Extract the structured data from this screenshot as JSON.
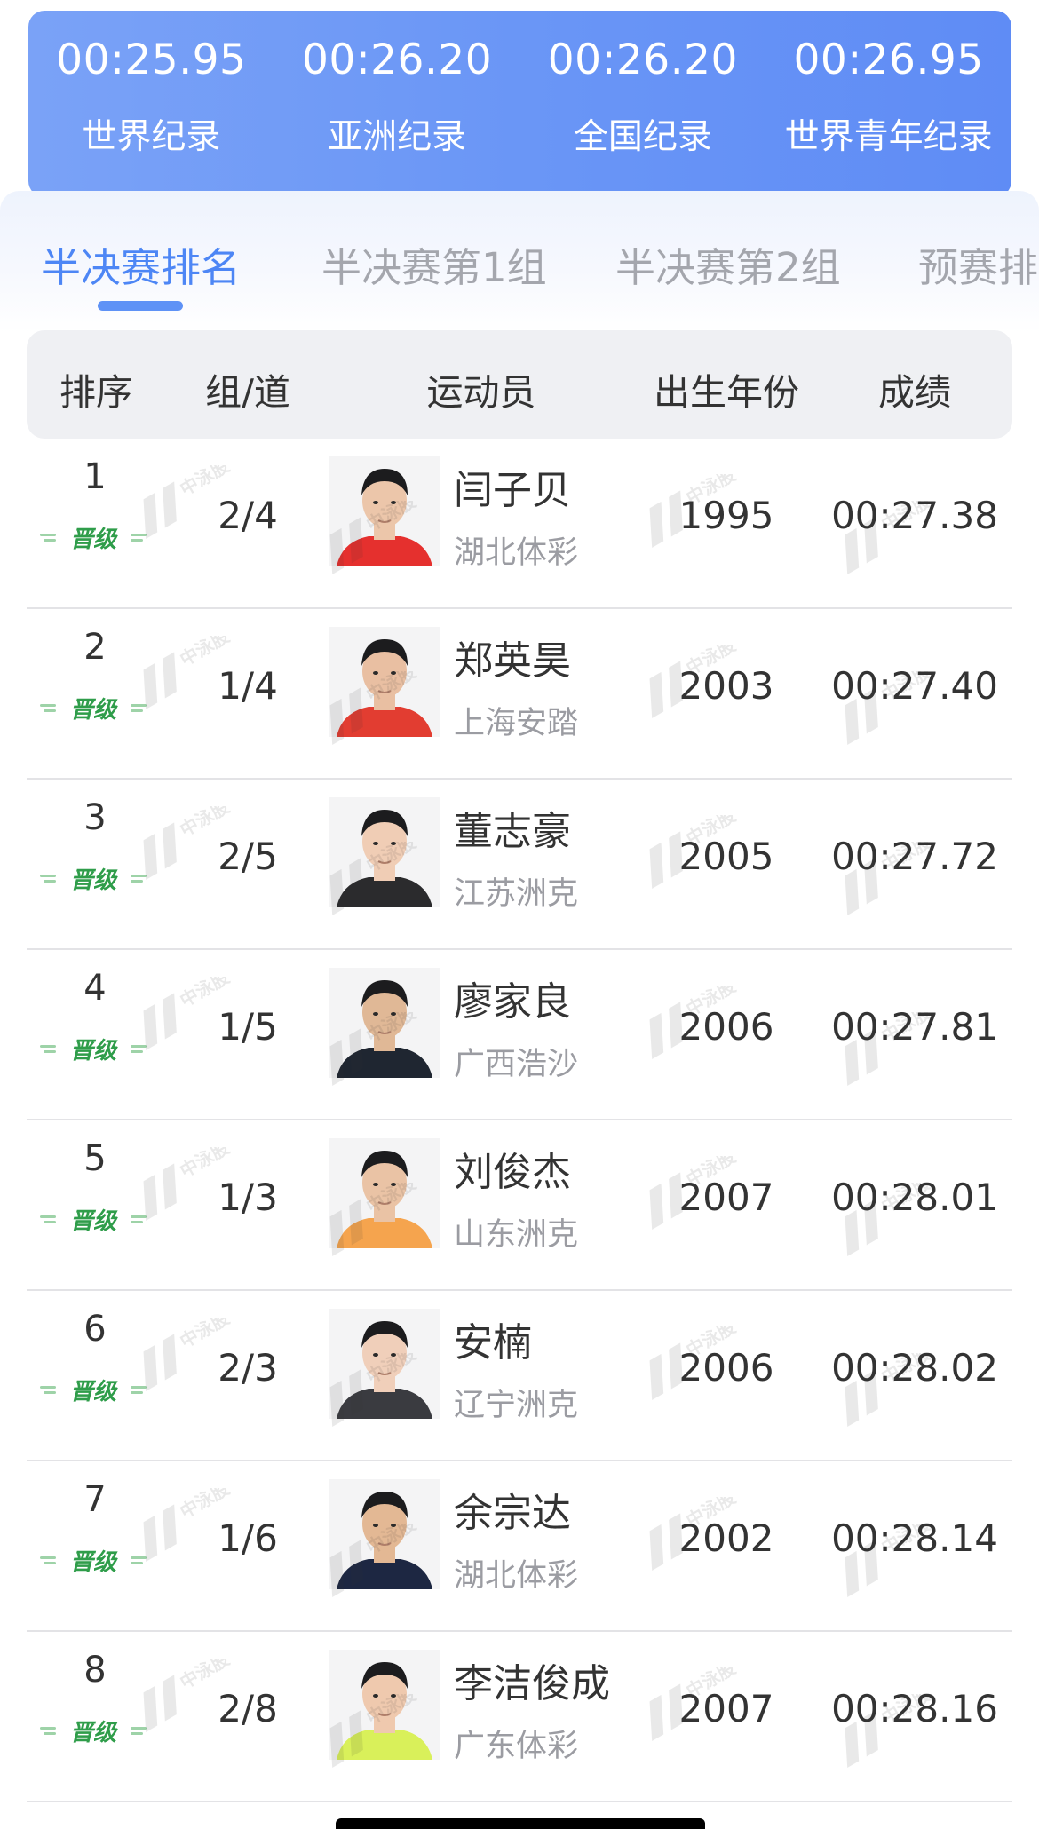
{
  "records": [
    {
      "time": "00:25.95",
      "label": "世界纪录"
    },
    {
      "time": "00:26.20",
      "label": "亚洲纪录"
    },
    {
      "time": "00:26.20",
      "label": "全国纪录"
    },
    {
      "time": "00:26.95",
      "label": "世界青年纪录"
    }
  ],
  "tabs": [
    {
      "label": "半决赛排名",
      "active": true
    },
    {
      "label": "半决赛第1组",
      "active": false
    },
    {
      "label": "半决赛第2组",
      "active": false
    },
    {
      "label": "预赛排名",
      "active": false
    }
  ],
  "table": {
    "headers": {
      "rank": "排序",
      "lane": "组/道",
      "athlete": "运动员",
      "birth_year": "出生年份",
      "score": "成绩"
    },
    "qualified_badge": "晋级",
    "watermark": "中泳股份",
    "rows": [
      {
        "rank": "1",
        "lane": "2/4",
        "name": "闫子贝",
        "team": "湖北体彩",
        "year": "1995",
        "score": "00:27.38",
        "shirt": "#e5302e",
        "skin": "#ecc6aa"
      },
      {
        "rank": "2",
        "lane": "1/4",
        "name": "郑英昊",
        "team": "上海安踏",
        "year": "2003",
        "score": "00:27.40",
        "shirt": "#e23d31",
        "skin": "#e9bfa2"
      },
      {
        "rank": "3",
        "lane": "2/5",
        "name": "董志豪",
        "team": "江苏洲克",
        "year": "2005",
        "score": "00:27.72",
        "shirt": "#2b2b2d",
        "skin": "#f0cdb5"
      },
      {
        "rank": "4",
        "lane": "1/5",
        "name": "廖家良",
        "team": "广西浩沙",
        "year": "2006",
        "score": "00:27.81",
        "shirt": "#1f2631",
        "skin": "#e0b896"
      },
      {
        "rank": "5",
        "lane": "1/3",
        "name": "刘俊杰",
        "team": "山东洲克",
        "year": "2007",
        "score": "00:28.01",
        "shirt": "#f5a44e",
        "skin": "#eac3a5"
      },
      {
        "rank": "6",
        "lane": "2/3",
        "name": "安楠",
        "team": "辽宁洲克",
        "year": "2006",
        "score": "00:28.02",
        "shirt": "#3a3b40",
        "skin": "#f0cfba"
      },
      {
        "rank": "7",
        "lane": "1/6",
        "name": "余宗达",
        "team": "湖北体彩",
        "year": "2002",
        "score": "00:28.14",
        "shirt": "#1d2742",
        "skin": "#e3b894"
      },
      {
        "rank": "8",
        "lane": "2/8",
        "name": "李洁俊成",
        "team": "广东体彩",
        "year": "2007",
        "score": "00:28.16",
        "shirt": "#d9f05a",
        "skin": "#efc9ae"
      }
    ]
  },
  "colors": {
    "banner": "#6a96f6",
    "tab_active": "#4d86f5",
    "tab_inactive": "#a4a6ad",
    "badge_green": "#2f9d4a",
    "team_gray": "#9b9ca2"
  }
}
